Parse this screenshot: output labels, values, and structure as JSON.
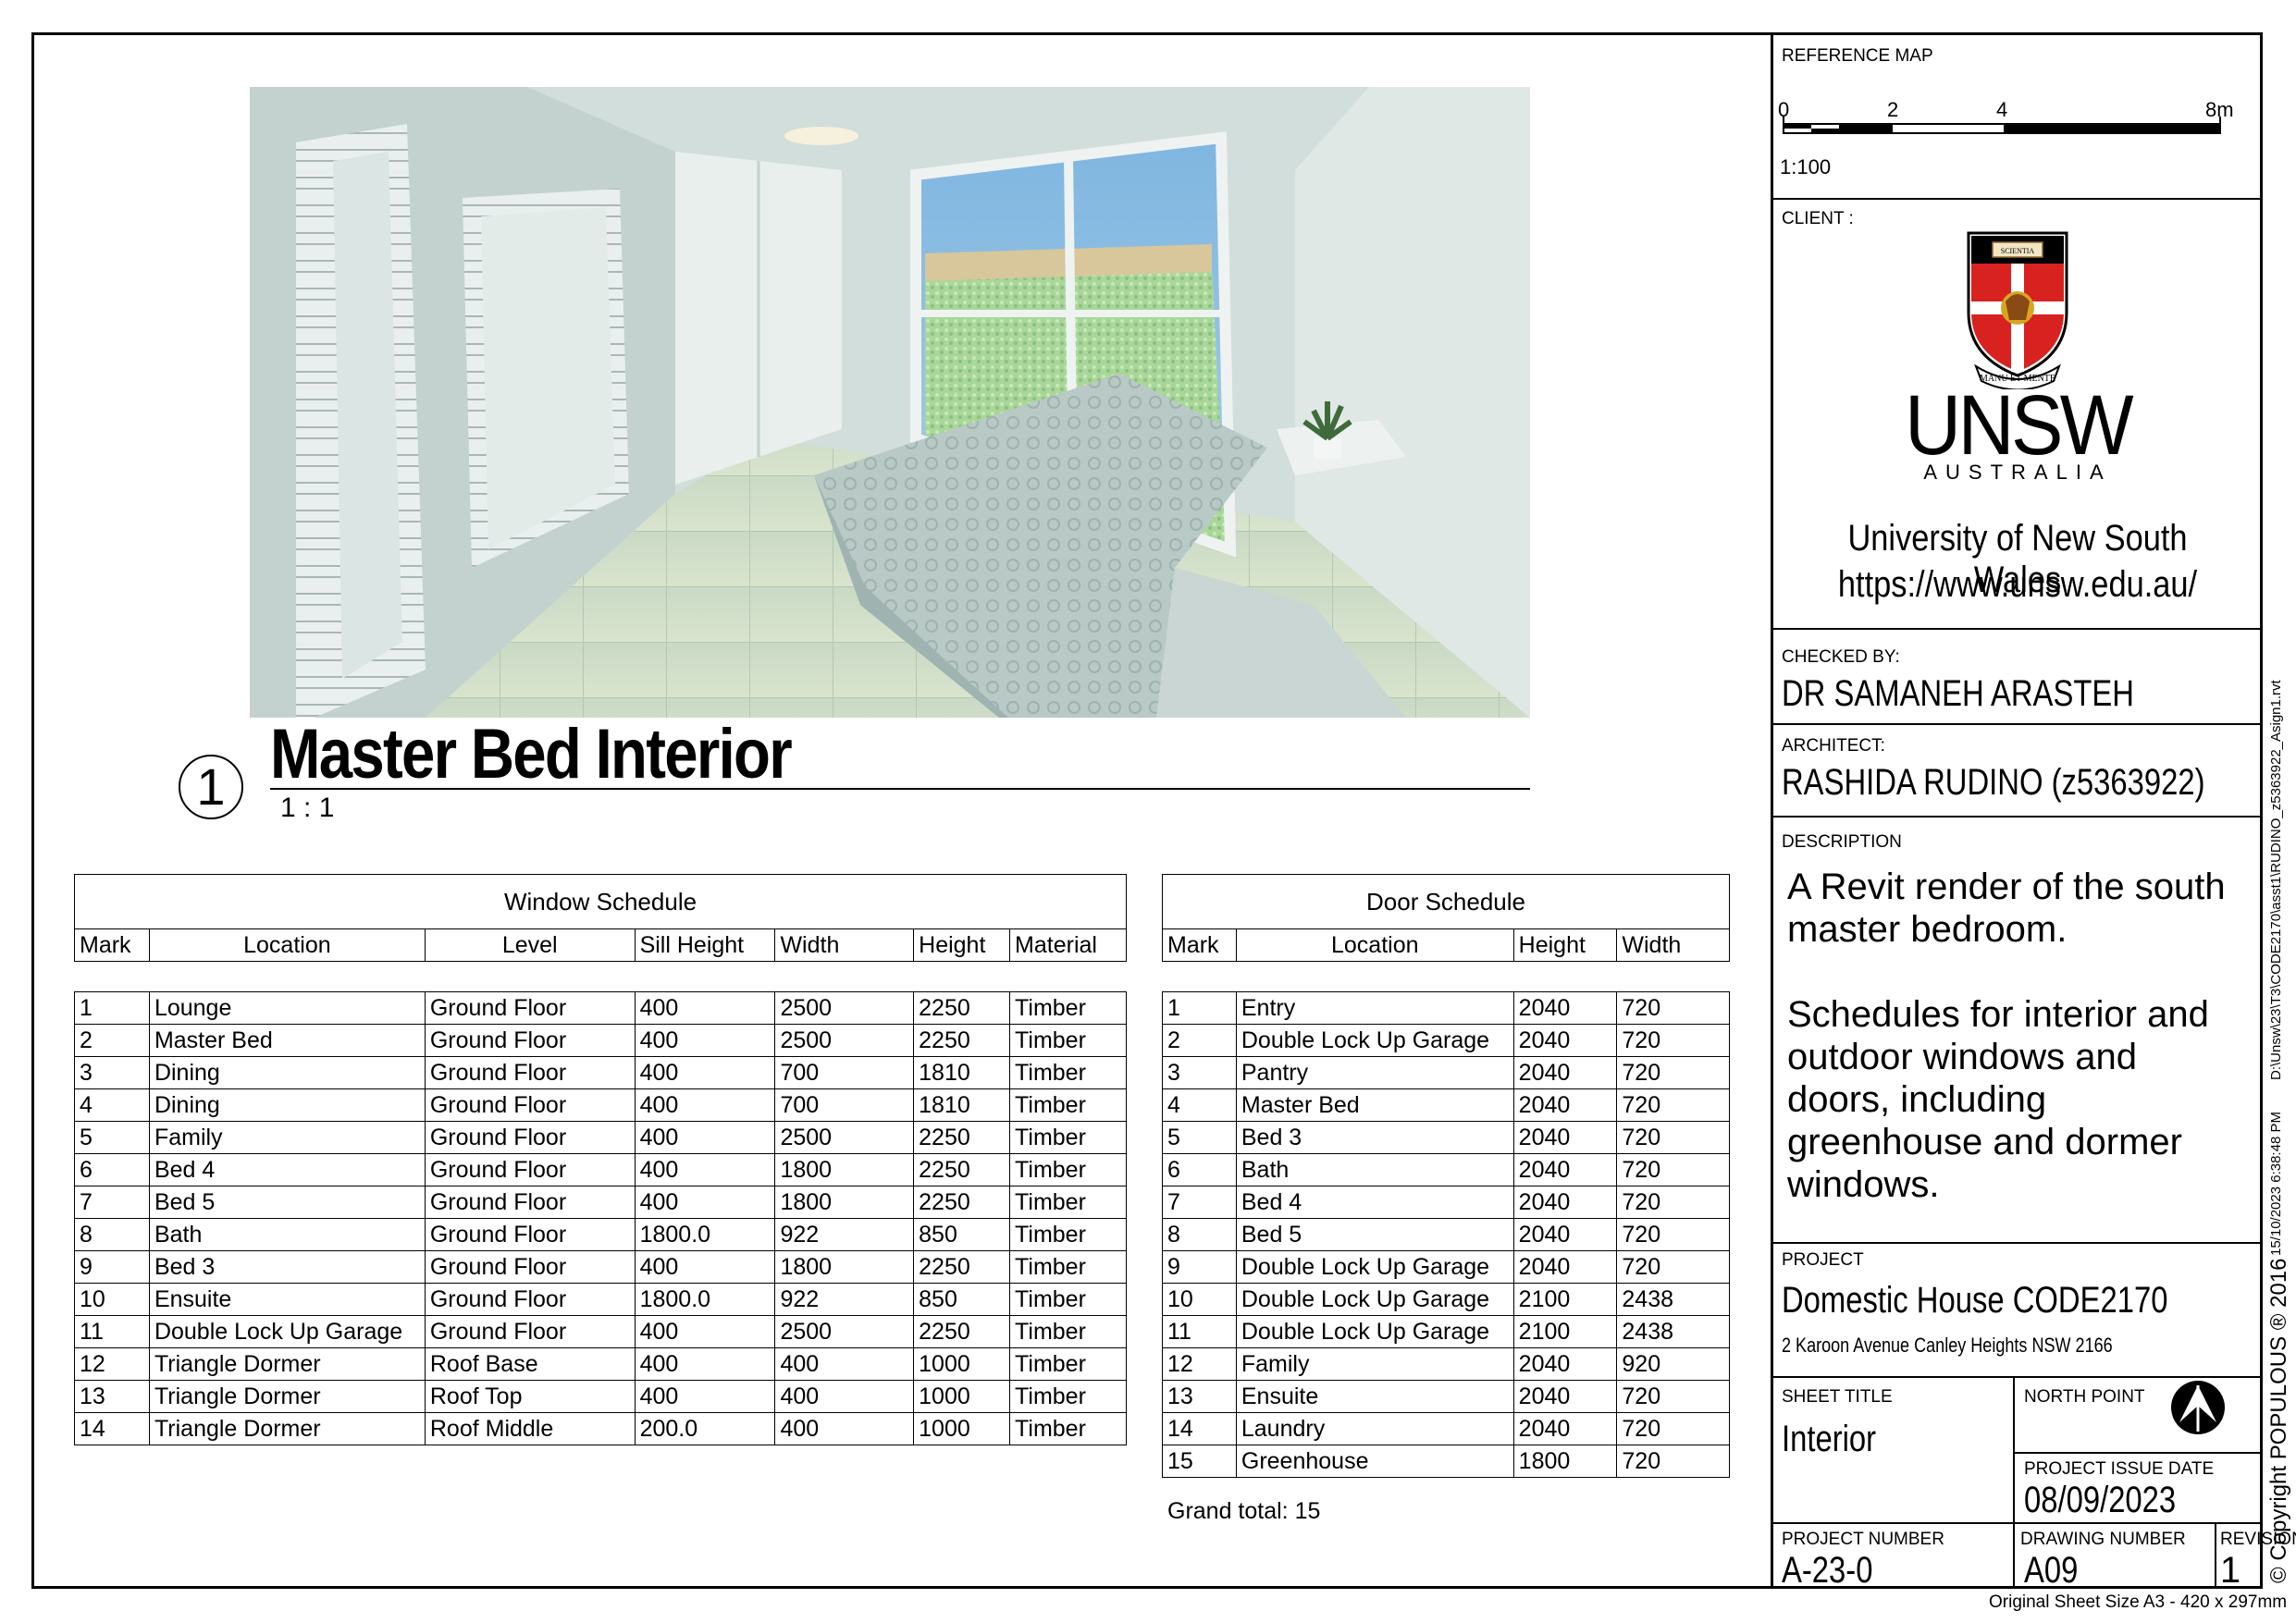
{
  "view": {
    "number": "1",
    "title": "Master Bed Interior",
    "scale": "1 : 1"
  },
  "window_schedule": {
    "title": "Window Schedule",
    "columns": [
      "Mark",
      "Location",
      "Level",
      "Sill Height",
      "Width",
      "Height",
      "Material"
    ],
    "rows": [
      [
        "1",
        "Lounge",
        "Ground Floor",
        "400",
        "2500",
        "2250",
        "Timber"
      ],
      [
        "2",
        "Master Bed",
        "Ground Floor",
        "400",
        "2500",
        "2250",
        "Timber"
      ],
      [
        "3",
        "Dining",
        "Ground Floor",
        "400",
        "700",
        "1810",
        "Timber"
      ],
      [
        "4",
        "Dining",
        "Ground Floor",
        "400",
        "700",
        "1810",
        "Timber"
      ],
      [
        "5",
        "Family",
        "Ground Floor",
        "400",
        "2500",
        "2250",
        "Timber"
      ],
      [
        "6",
        "Bed 4",
        "Ground Floor",
        "400",
        "1800",
        "2250",
        "Timber"
      ],
      [
        "7",
        "Bed 5",
        "Ground Floor",
        "400",
        "1800",
        "2250",
        "Timber"
      ],
      [
        "8",
        "Bath",
        "Ground Floor",
        "1800.0",
        "922",
        "850",
        "Timber"
      ],
      [
        "9",
        "Bed 3",
        "Ground Floor",
        "400",
        "1800",
        "2250",
        "Timber"
      ],
      [
        "10",
        "Ensuite",
        "Ground Floor",
        "1800.0",
        "922",
        "850",
        "Timber"
      ],
      [
        "11",
        "Double Lock Up Garage",
        "Ground Floor",
        "400",
        "2500",
        "2250",
        "Timber"
      ],
      [
        "12",
        "Triangle Dormer",
        "Roof Base",
        "400",
        "400",
        "1000",
        "Timber"
      ],
      [
        "13",
        "Triangle Dormer",
        "Roof Top",
        "400",
        "400",
        "1000",
        "Timber"
      ],
      [
        "14",
        "Triangle Dormer",
        "Roof Middle",
        "200.0",
        "400",
        "1000",
        "Timber"
      ]
    ]
  },
  "door_schedule": {
    "title": "Door Schedule",
    "columns": [
      "Mark",
      "Location",
      "Height",
      "Width"
    ],
    "rows": [
      [
        "1",
        "Entry",
        "2040",
        "720"
      ],
      [
        "2",
        "Double Lock Up Garage",
        "2040",
        "720"
      ],
      [
        "3",
        "Pantry",
        "2040",
        "720"
      ],
      [
        "4",
        "Master Bed",
        "2040",
        "720"
      ],
      [
        "5",
        "Bed 3",
        "2040",
        "720"
      ],
      [
        "6",
        "Bath",
        "2040",
        "720"
      ],
      [
        "7",
        "Bed 4",
        "2040",
        "720"
      ],
      [
        "8",
        "Bed 5",
        "2040",
        "720"
      ],
      [
        "9",
        "Double Lock Up Garage",
        "2040",
        "720"
      ],
      [
        "10",
        "Double Lock Up Garage",
        "2100",
        "2438"
      ],
      [
        "11",
        "Double Lock Up Garage",
        "2100",
        "2438"
      ],
      [
        "12",
        "Family",
        "2040",
        "920"
      ],
      [
        "13",
        "Ensuite",
        "2040",
        "720"
      ],
      [
        "14",
        "Laundry",
        "2040",
        "720"
      ],
      [
        "15",
        "Greenhouse",
        "1800",
        "720"
      ]
    ],
    "grand_total": "Grand total: 15"
  },
  "title_block": {
    "reference_map_label": "REFERENCE MAP",
    "scale_bar_ticks": [
      "0",
      "2",
      "4",
      "8m"
    ],
    "scale_ratio": "1:100",
    "client_label": "CLIENT :",
    "logo_wordmark": "UNSW",
    "logo_sub": "AUSTRALIA",
    "logo_motto": "MANU ET MENTE",
    "logo_book": "SCIENTIA",
    "client_name": "University of New South Wales",
    "client_url": "https://www.unsw.edu.au/",
    "checked_by_label": "CHECKED BY:",
    "checked_by": "DR SAMANEH ARASTEH",
    "architect_label": "ARCHITECT:",
    "architect": "RASHIDA RUDINO (z5363922)",
    "description_label": "DESCRIPTION",
    "description_1": "A Revit render of the south master bedroom.",
    "description_2": "Schedules for interior and outdoor windows and doors, including greenhouse and dormer windows.",
    "project_label": "PROJECT",
    "project_name": "Domestic House CODE2170",
    "project_address": "2 Karoon Avenue Canley Heights NSW 2166",
    "sheet_title_label": "SHEET TITLE",
    "sheet_title": "Interior",
    "north_point_label": "NORTH POINT",
    "issue_date_label": "PROJECT ISSUE DATE",
    "issue_date": "08/09/2023",
    "project_number_label": "PROJECT NUMBER",
    "project_number": "A-23-0",
    "drawing_number_label": "DRAWING NUMBER",
    "drawing_number": "A09",
    "revision_label": "REVISION",
    "revision": "1"
  },
  "margin": {
    "file_path": "D:\\Unsw\\23\\T3\\CODE2170\\asst1\\RUDINO_z5363922_Asign1.rvt",
    "timestamp": "15/10/2023 6:38:48 PM",
    "copyright": "© Copyright  POPULOUS ® 2016",
    "sheet_size": "Original Sheet Size A3 - 420 x 297mm"
  }
}
